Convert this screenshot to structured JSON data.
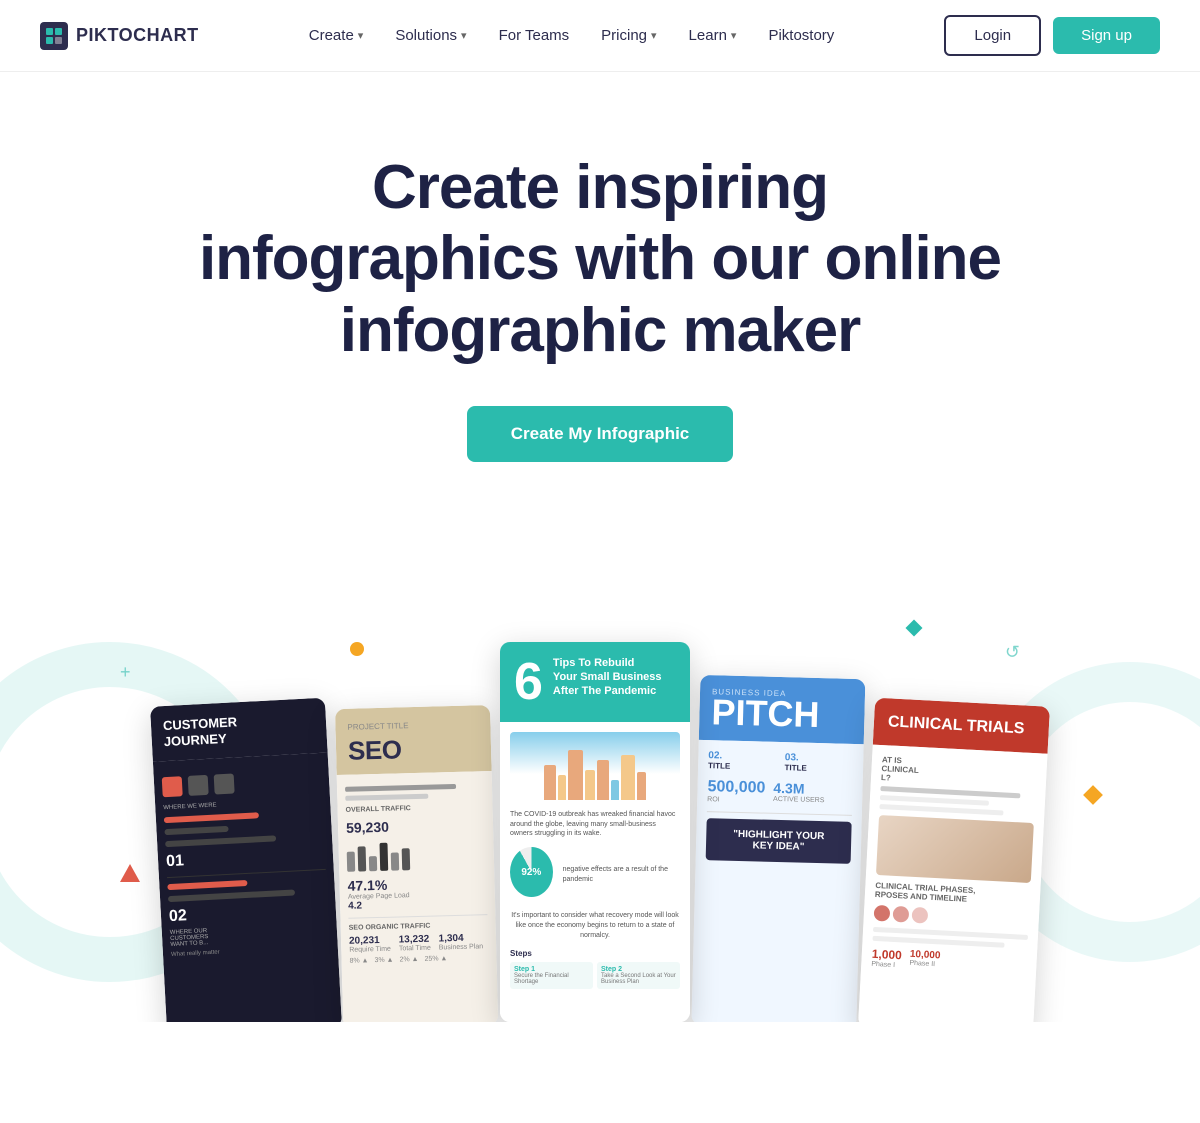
{
  "brand": {
    "name": "PIKTOCHART",
    "logo_alt": "Piktochart logo"
  },
  "nav": {
    "links": [
      {
        "label": "Create",
        "has_dropdown": true
      },
      {
        "label": "Solutions",
        "has_dropdown": true
      },
      {
        "label": "For Teams",
        "has_dropdown": false
      },
      {
        "label": "Pricing",
        "has_dropdown": true
      },
      {
        "label": "Learn",
        "has_dropdown": true
      },
      {
        "label": "Piktostory",
        "has_dropdown": false
      }
    ],
    "login_label": "Login",
    "signup_label": "Sign up"
  },
  "hero": {
    "title": "Create inspiring infographics with our online infographic maker",
    "cta_label": "Create My Infographic"
  },
  "showcase": {
    "cards": [
      {
        "type": "customer",
        "title": "CUSTOMER\njourney"
      },
      {
        "type": "seo",
        "title": "SEO",
        "number": "59,230",
        "number2": "47.1%",
        "number3": "20,231",
        "number4": "13,232",
        "number5": "1,304"
      },
      {
        "type": "tips",
        "number": "6",
        "heading": "Tips To Rebuild\nYour Small Business\nAfter The Pandemic",
        "stat": "92%",
        "footer": "It's important to consider what recovery mode will look like once the economy begins to return to a state of normalcy."
      },
      {
        "type": "pitch",
        "label": "BUSINESS IDEA",
        "title": "PITCH",
        "stat1": "500,000",
        "stat1_label": "ROI",
        "stat2": "4.3M",
        "stat2_label": "ACTIVE USERS",
        "highlight": "\"HIGHLIGHT YOUR\nKEY IDEA\""
      },
      {
        "type": "clinical",
        "title": "CLINICAL\nTRIALS"
      }
    ]
  }
}
